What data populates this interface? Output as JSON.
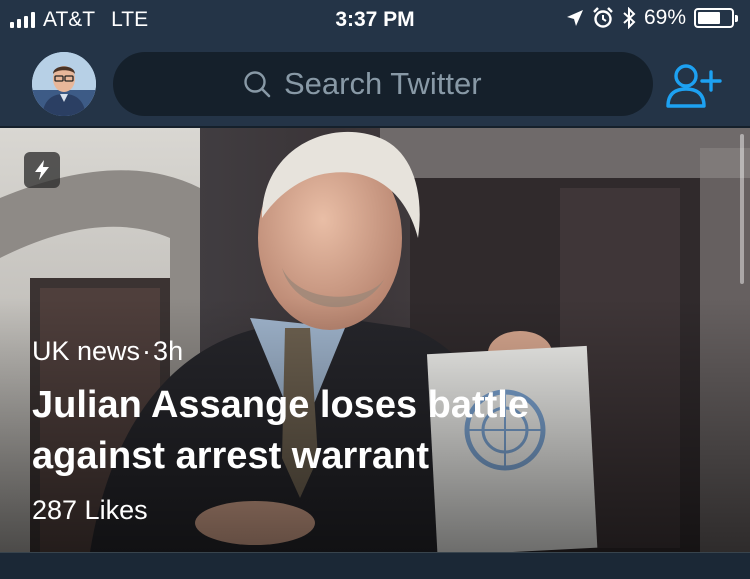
{
  "status_bar": {
    "carrier": "AT&T",
    "network": "LTE",
    "time": "3:37 PM",
    "battery_percent": "69%",
    "battery_level": 0.69,
    "icons": [
      "location-arrow-icon",
      "alarm-icon",
      "bluetooth-icon"
    ]
  },
  "header": {
    "search_placeholder": "Search Twitter",
    "accent_color": "#1da1f2"
  },
  "moment": {
    "category": "UK news",
    "separator": "·",
    "age": "3h",
    "title": "Julian Assange loses battle against arrest warrant",
    "likes": "287 Likes",
    "badge_icon": "lightning-bolt-icon"
  }
}
